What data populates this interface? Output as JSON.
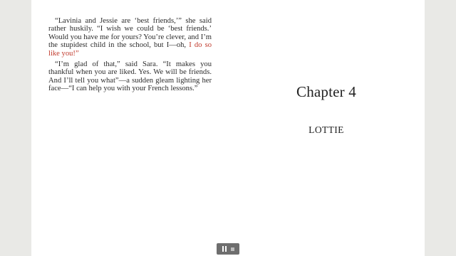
{
  "left_page": {
    "paragraphs": [
      {
        "text": "“Lavinia and Jessie are ‘best friends,’” she said rather huskily. “I wish we could be ‘best friends.’ Would you have me for yours? You’re clever, and I’m the stupidest child in the school, but I—oh, ",
        "highlight": "I do so like you!”"
      },
      {
        "text": "“I’m glad of that,” said Sara. “It makes you thankful when you are liked. Yes. We will be friends. And I’ll tell you what”—a sudden gleam lighting her face—“I can help you with your French lessons.”",
        "highlight": ""
      }
    ]
  },
  "right_page": {
    "chapter_title": "Chapter 4",
    "chapter_name": "LOTTIE"
  },
  "playback": {
    "pause_icon": "pause-icon",
    "stop_icon": "stop-icon"
  },
  "colors": {
    "highlight": "#c0392b",
    "background": "#e9e9e6",
    "page": "#ffffff"
  }
}
